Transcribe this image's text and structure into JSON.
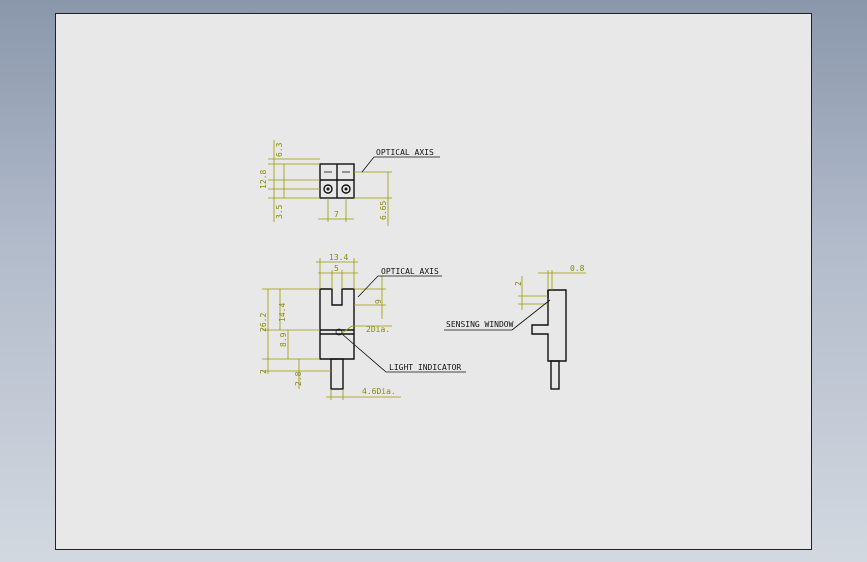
{
  "drawing": {
    "colors": {
      "background_top": "#8a97ab",
      "sheet": "#e8e8e8",
      "dimension": "#9a9a00",
      "outline": "#111111"
    },
    "top_view": {
      "dims": {
        "d_6_3": "6.3",
        "d_12_8": "12.8",
        "d_3_5": "3.5",
        "d_7": "7",
        "d_6_65": "6.65"
      },
      "note_optical_axis": "OPTICAL AXIS"
    },
    "front_view": {
      "dims": {
        "d_13_4": "13.4",
        "d_5": "5",
        "d_9": "9",
        "d_26_2": "26.2",
        "d_14_4": "14.4",
        "d_8_9": "8.9",
        "d_2": "2",
        "d_2_8": "2.8",
        "d_2dia": "2Dia.",
        "d_4_6dia": "4.6Dia."
      },
      "note_optical_axis": "OPTICAL AXIS",
      "note_light_indicator": "LIGHT INDICATOR"
    },
    "side_view": {
      "dims": {
        "d_0_8": "0.8",
        "d_2": "2"
      },
      "note_sensing_window": "SENSING WINDOW"
    }
  }
}
